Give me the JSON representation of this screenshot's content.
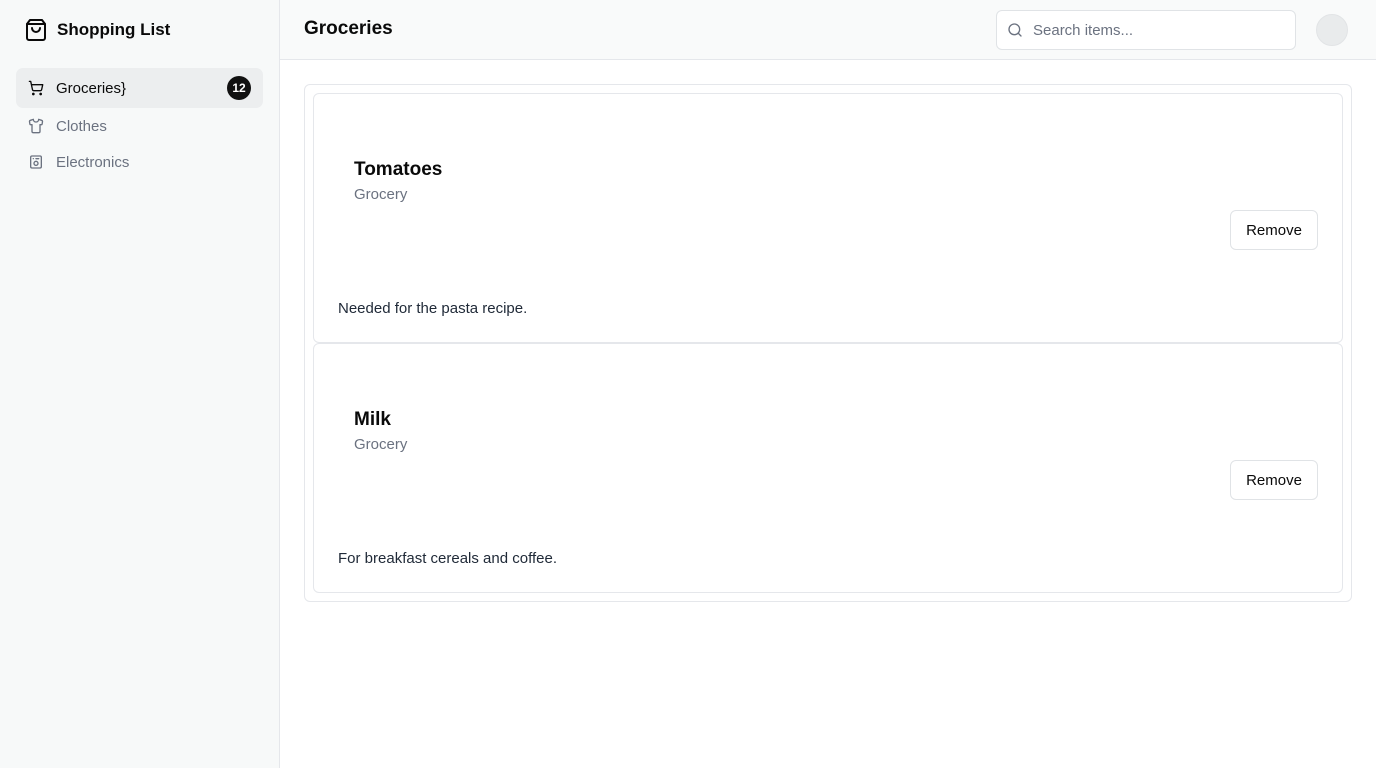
{
  "app": {
    "title": "Shopping List"
  },
  "sidebar": {
    "items": [
      {
        "label": "Groceries}",
        "badge": "12",
        "icon": "cart-icon",
        "active": true
      },
      {
        "label": "Clothes",
        "icon": "shirt-icon",
        "active": false
      },
      {
        "label": "Electronics",
        "icon": "device-icon",
        "active": false
      }
    ]
  },
  "header": {
    "title": "Groceries",
    "search_placeholder": "Search items...",
    "search_value": ""
  },
  "items": [
    {
      "name": "Tomatoes",
      "category": "Grocery",
      "note": "Needed for the pasta recipe.",
      "action": "Remove"
    },
    {
      "name": "Milk",
      "category": "Grocery",
      "note": "For breakfast cereals and coffee.",
      "action": "Remove"
    }
  ],
  "colors": {
    "accent": "#111111",
    "muted_text": "#6b7280",
    "border": "#e5e7eb",
    "sidebar_bg": "#f7f9f9"
  }
}
